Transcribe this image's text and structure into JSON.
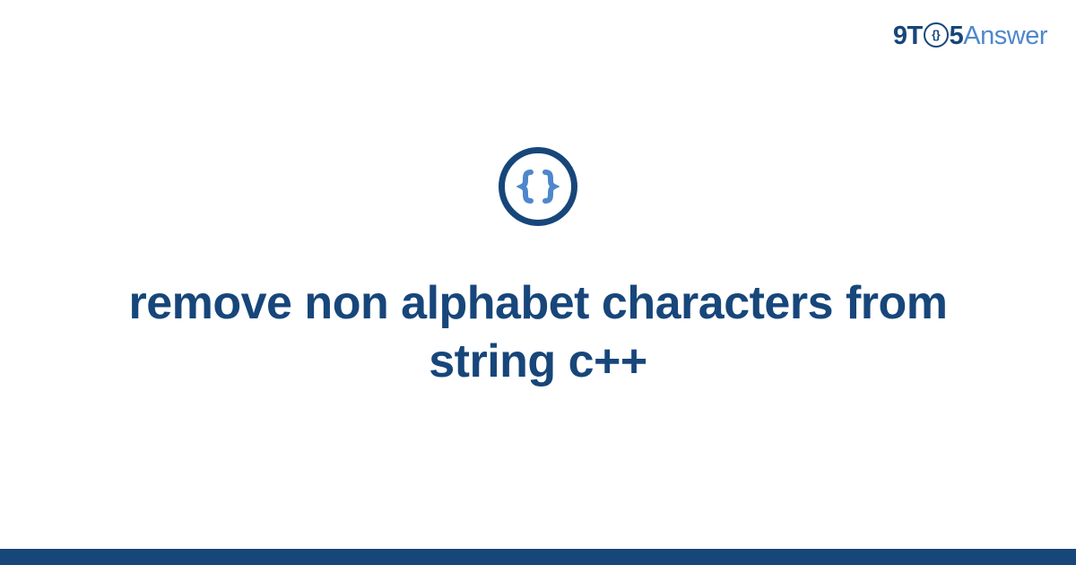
{
  "logo": {
    "part1": "9T",
    "circle_text": "{}",
    "part2": "5",
    "part3": "Answer"
  },
  "icon": {
    "name": "code-braces",
    "ring_color": "#17467a",
    "brace_color": "#4f87cc"
  },
  "title": "remove non alphabet characters from string c++",
  "colors": {
    "primary": "#17467a",
    "accent": "#4f87cc",
    "background": "#ffffff"
  }
}
